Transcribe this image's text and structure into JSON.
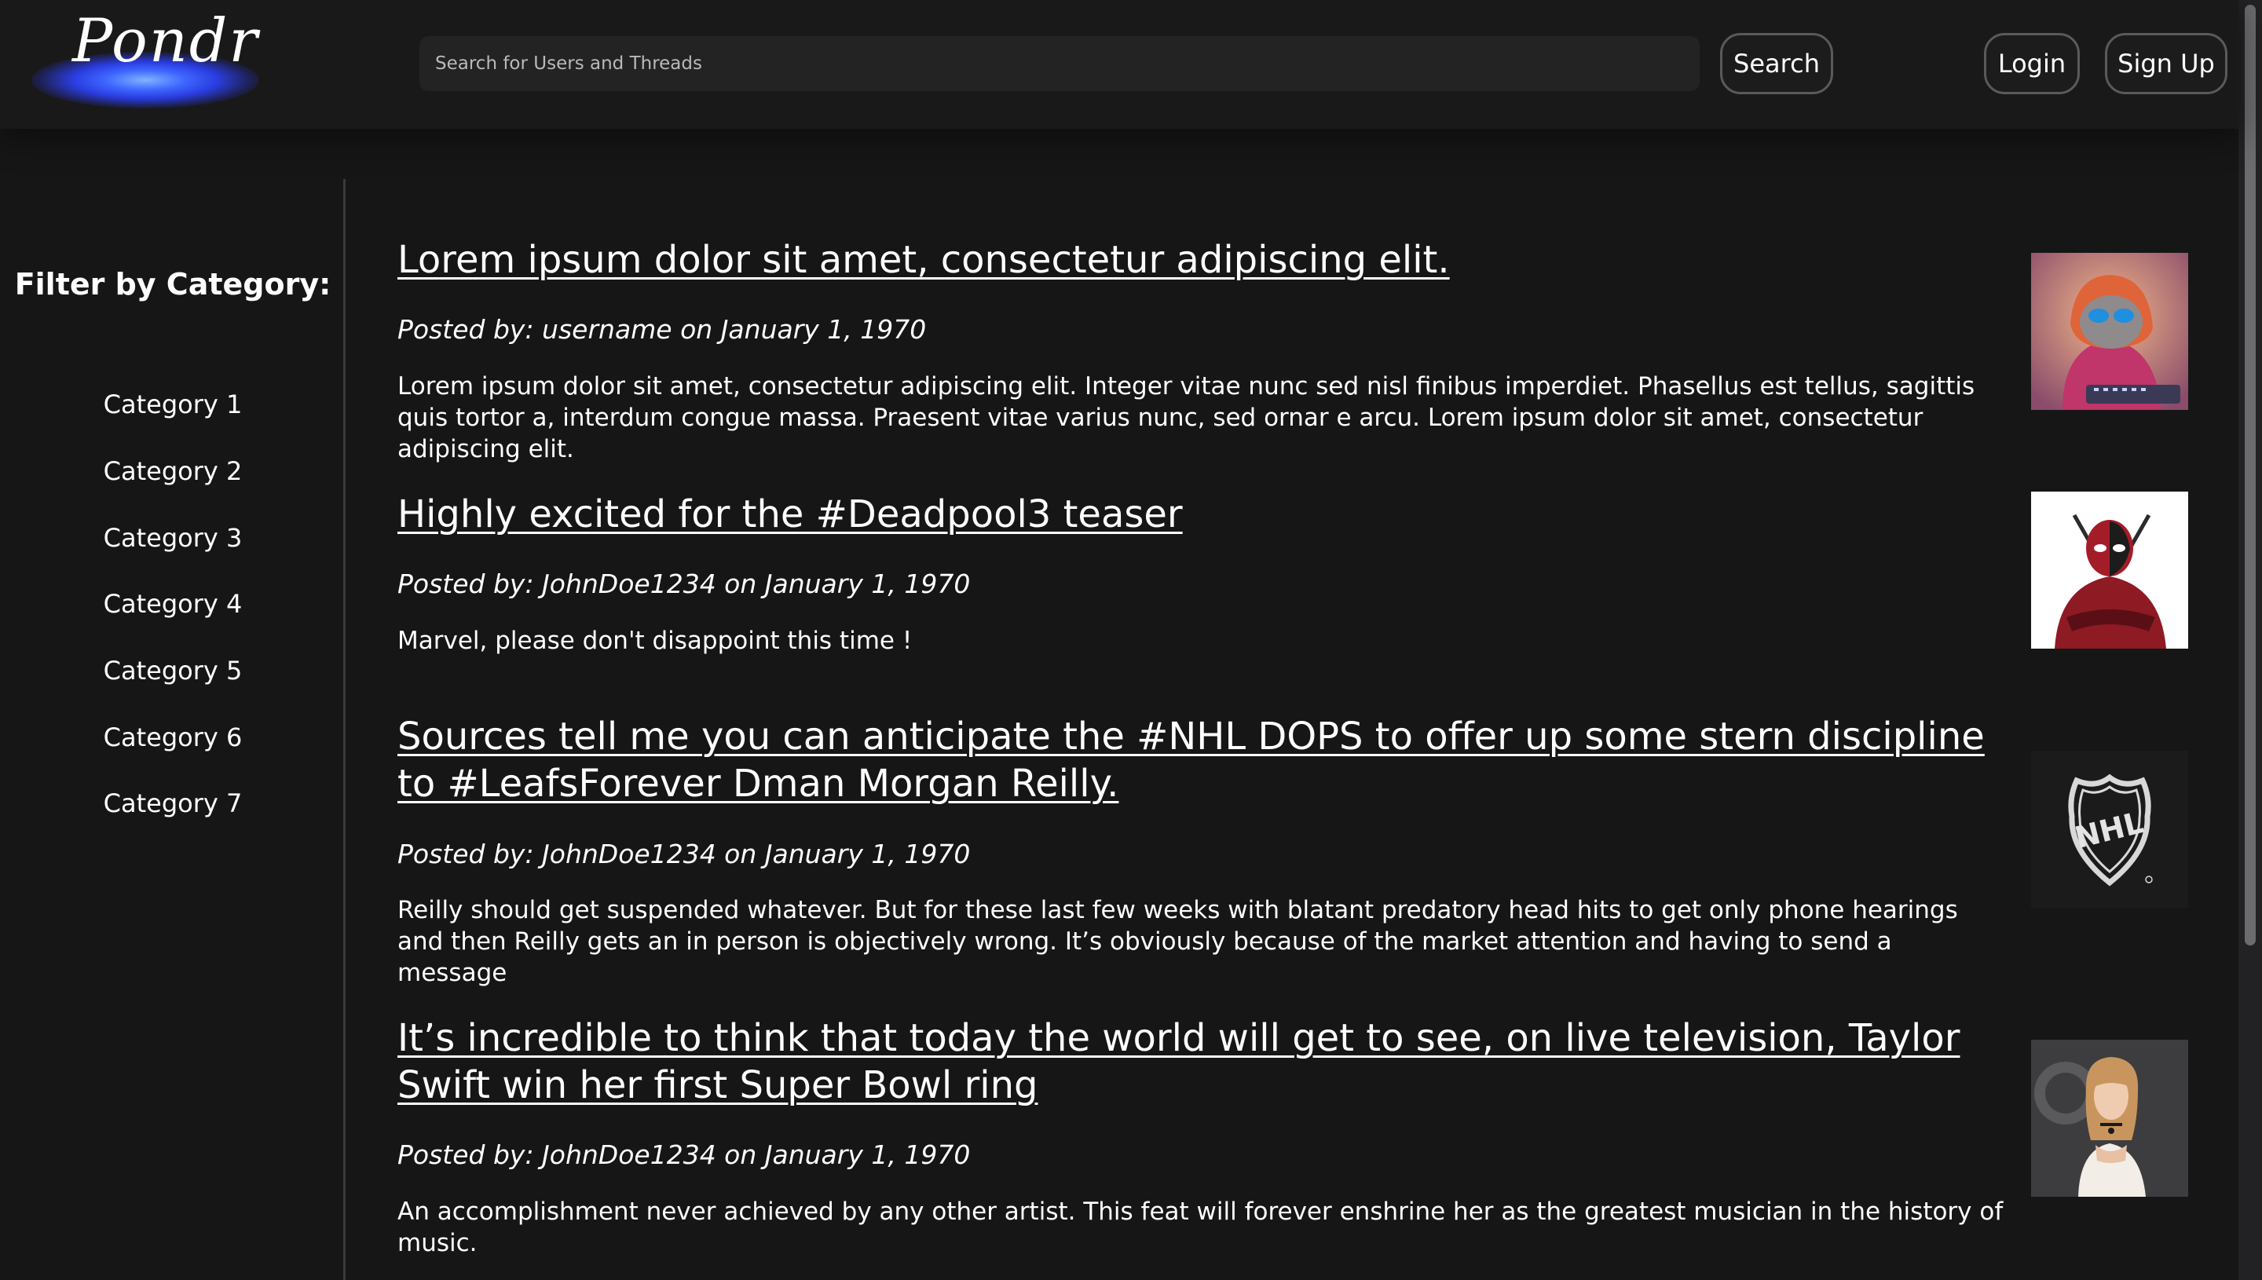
{
  "header": {
    "logo_text": "Pondr",
    "search_placeholder": "Search for Users and Threads",
    "search_button": "Search",
    "login_button": "Login",
    "signup_button": "Sign Up"
  },
  "sidebar": {
    "title": "Filter by Category:",
    "categories": [
      "Category 1",
      "Category 2",
      "Category 3",
      "Category 4",
      "Category 5",
      "Category 6",
      "Category 7"
    ]
  },
  "posts": [
    {
      "title": "Lorem ipsum dolor sit amet, consectetur adipiscing elit.",
      "meta": "Posted by: username on January 1, 1970",
      "body": "Lorem ipsum dolor sit amet, consectetur adipiscing elit. Integer vitae nunc sed nisl finibus imperdiet. Phasellus est tellus, sagittis quis tortor a, interdum congue massa. Praesent vitae varius nunc, sed ornar e arcu. Lorem ipsum dolor sit amet, consectetur adipiscing elit.",
      "thumbnail": "cat-hoodie-image"
    },
    {
      "title": "Highly excited for the #Deadpool3 teaser",
      "meta": "Posted by: JohnDoe1234 on January 1, 1970",
      "body": "Marvel, please don't disappoint this time !",
      "thumbnail": "deadpool-image"
    },
    {
      "title": "Sources tell me you can anticipate the #NHL DOPS to offer up some stern discipline to #LeafsForever Dman Morgan Reilly.",
      "meta": "Posted by: JohnDoe1234 on January 1, 1970",
      "body": "Reilly should get suspended whatever. But for these last few weeks with blatant predatory head hits to get only phone hearings and then Reilly gets an in person is objectively wrong. It’s obviously because of the market attention and having to send a message",
      "thumbnail": "nhl-logo-image",
      "thumbnail_text": "NHL"
    },
    {
      "title": "It’s incredible to think that today the world will get to see, on live television, Taylor Swift win her first Super Bowl ring",
      "meta": "Posted by: JohnDoe1234 on January 1, 1970",
      "body": "An accomplishment never achieved by any other artist. This feat will forever enshrine her as the greatest musician in the history of music.",
      "thumbnail": "taylor-swift-image"
    }
  ],
  "colors": {
    "background": "#161617",
    "header": "#19191a",
    "accent_glow": "#3e66ff",
    "text": "#ffffff"
  }
}
